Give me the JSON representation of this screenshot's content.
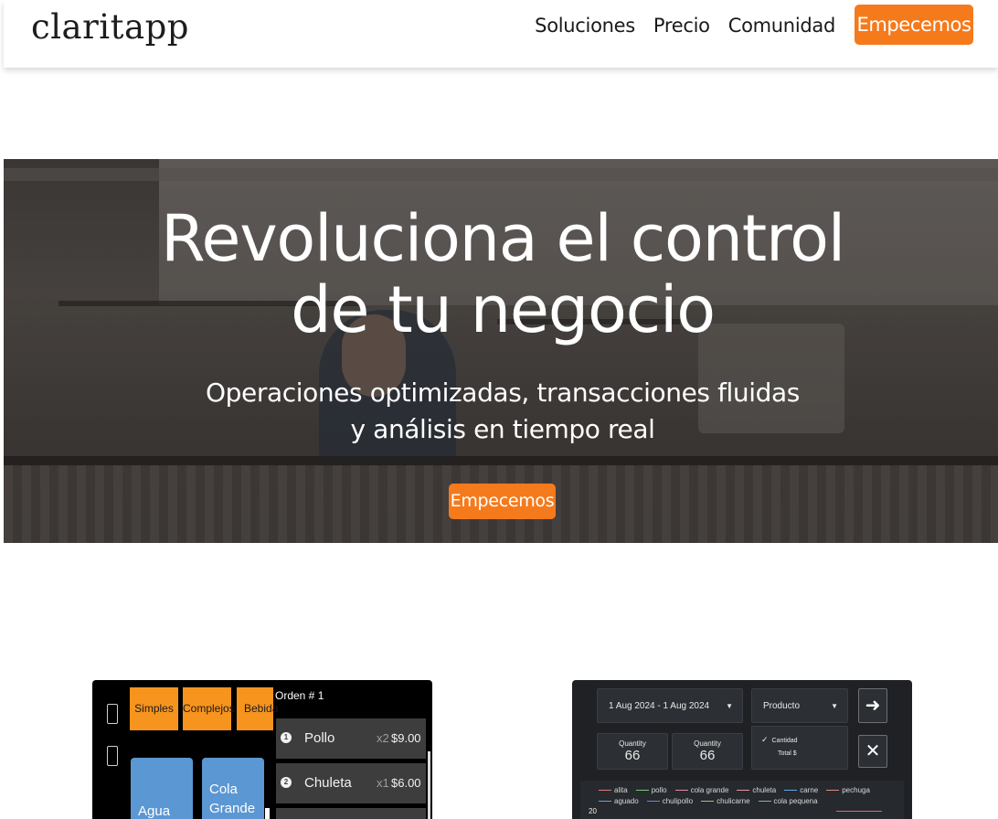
{
  "nav": {
    "logo": "claritapp",
    "links": [
      "Soluciones",
      "Precio",
      "Comunidad"
    ],
    "cta": "Empecemos"
  },
  "hero": {
    "title_line1": "Revoluciona el control",
    "title_line2": "de tu negocio",
    "subtitle_line1": "Operaciones optimizadas, transacciones fluidas",
    "subtitle_line2": "y análisis en tiempo real",
    "cta": "Empecemos"
  },
  "pos": {
    "categories": [
      "Simples",
      "Complejos",
      "Bebida"
    ],
    "tiles": [
      {
        "line1": "",
        "line2": "Agua"
      },
      {
        "line1": "Cola",
        "line2": "Grande"
      }
    ],
    "order_title": "Orden # 1",
    "order_lines": [
      {
        "num": "1",
        "name": "Pollo",
        "qty": "x2",
        "price": "$9.00"
      },
      {
        "num": "2",
        "name": "Chuleta",
        "qty": "x1",
        "price": "$6.00"
      }
    ]
  },
  "analytics": {
    "date_range": "1 Aug 2024 - 1 Aug 2024",
    "product_select": "Producto",
    "dropdown_options": [
      "Cantidad",
      "Total $"
    ],
    "cards": [
      {
        "label": "Quantity",
        "value": "66"
      },
      {
        "label": "Quantity",
        "value": "66"
      }
    ],
    "chart_y_tick": "20",
    "legend": [
      {
        "name": "alita",
        "color": "#e07a7a"
      },
      {
        "name": "pollo",
        "color": "#7ec77e"
      },
      {
        "name": "cola grande",
        "color": "#e88aa0"
      },
      {
        "name": "chuleta",
        "color": "#e09a9a"
      },
      {
        "name": "carne",
        "color": "#6aa8e0"
      },
      {
        "name": "pechuga",
        "color": "#e08a8a"
      },
      {
        "name": "aguado",
        "color": "#6a9fe0"
      },
      {
        "name": "chulipollo",
        "color": "#5f8fd0"
      },
      {
        "name": "chulicarne",
        "color": "#a8c07a"
      },
      {
        "name": "cola pequena",
        "color": "#7ab0c0"
      }
    ]
  }
}
